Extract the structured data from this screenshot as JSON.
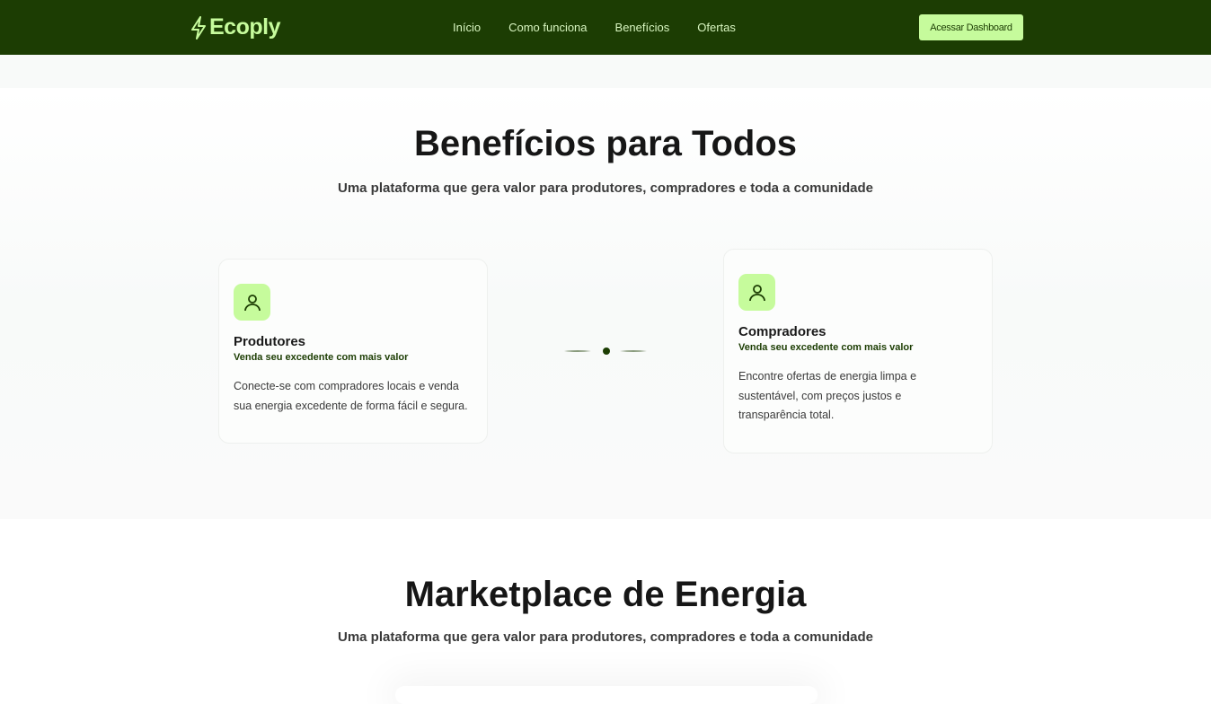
{
  "nav": {
    "brand": "Ecoply",
    "links": [
      "Início",
      "Como funciona",
      "Benefícios",
      "Ofertas"
    ],
    "cta": "Acessar Dashboard"
  },
  "benefits": {
    "title": "Benefícios para Todos",
    "subtitle": "Uma plataforma que gera valor para produtores, compradores e toda a comunidade",
    "cards": [
      {
        "title": "Produtores",
        "tagline": "Venda seu excedente com mais valor",
        "description": "Conecte-se com compradores locais e venda sua energia excedente de forma fácil e segura.",
        "icon": "user-icon"
      },
      {
        "title": "Compradores",
        "tagline": "Venda seu excedente com mais valor",
        "description": "Encontre ofertas de energia limpa e sustentável, com preços justos e transparência total.",
        "icon": "user-icon"
      }
    ]
  },
  "marketplace": {
    "title": "Marketplace de Energia",
    "subtitle": "Uma plataforma que gera valor para produtores, compradores e toda a comunidade"
  },
  "colors": {
    "brand": "#1c3d03",
    "accent": "#c6fb9c"
  }
}
